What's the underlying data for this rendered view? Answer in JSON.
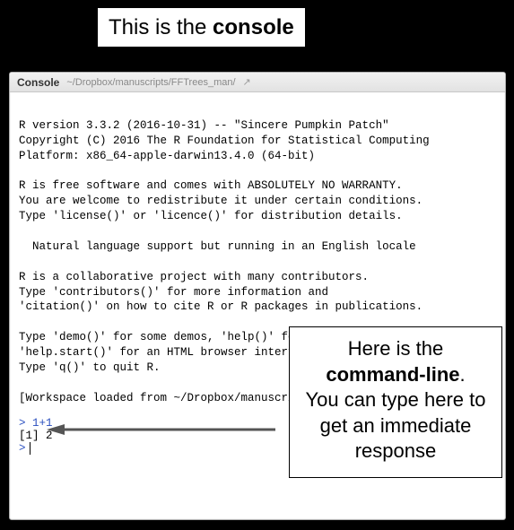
{
  "labels": {
    "top_prefix": "This is the ",
    "top_bold": "console",
    "bottom_line1": "Here is the",
    "bottom_bold": "command-line",
    "bottom_suffix": ".",
    "bottom_line3": "You can type here to get an immediate response"
  },
  "titlebar": {
    "tab": "Console",
    "path": "~/Dropbox/manuscripts/FFTrees_man/",
    "popout_icon": "↗"
  },
  "console": {
    "banner": "\nR version 3.3.2 (2016-10-31) -- \"Sincere Pumpkin Patch\"\nCopyright (C) 2016 The R Foundation for Statistical Computing\nPlatform: x86_64-apple-darwin13.4.0 (64-bit)\n\nR is free software and comes with ABSOLUTELY NO WARRANTY.\nYou are welcome to redistribute it under certain conditions.\nType 'license()' or 'licence()' for distribution details.\n\n  Natural language support but running in an English locale\n\nR is a collaborative project with many contributors.\nType 'contributors()' for more information and\n'citation()' on how to cite R or R packages in publications.\n\nType 'demo()' for some demos, 'help()' for on-line help, or\n'help.start()' for an HTML browser interface to help.\nType 'q()' to quit R.\n\n[Workspace loaded from ~/Dropbox/manuscripts/FFTrees_man/.RData]\n",
    "history_input": "> 1+1",
    "history_output": "[1] 2",
    "prompt": ">",
    "current_input": ""
  },
  "icons": {
    "arrow": "arrow-left"
  }
}
